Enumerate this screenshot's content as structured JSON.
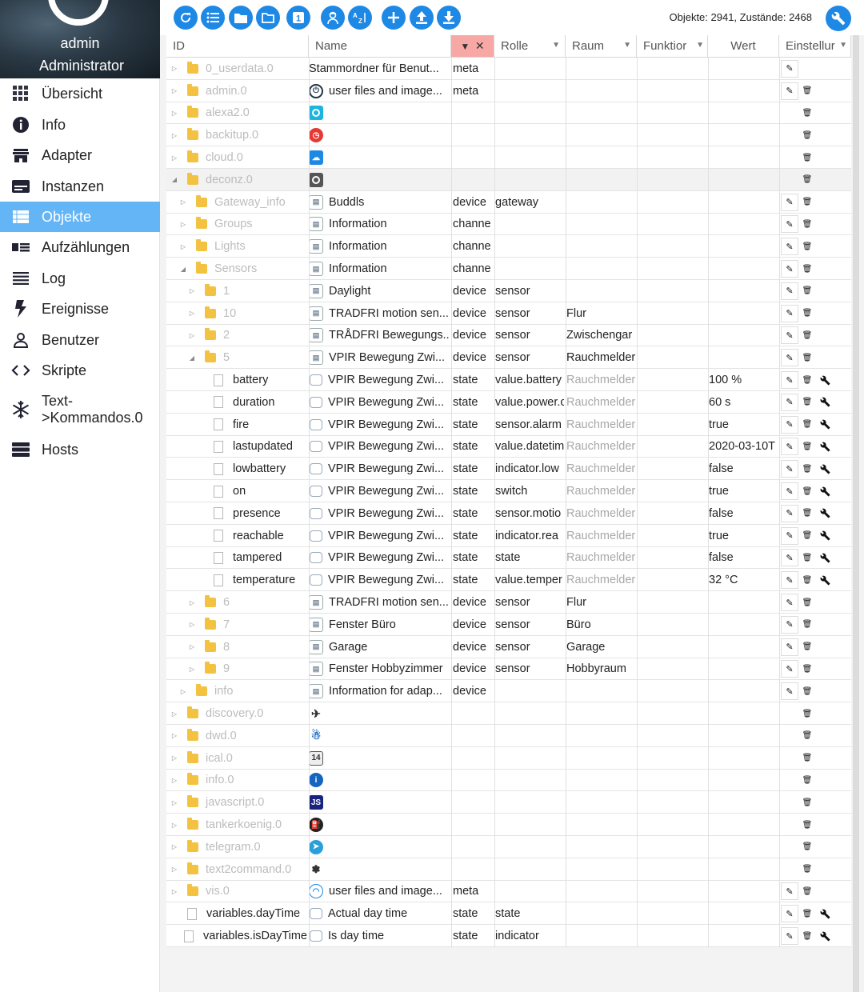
{
  "user": {
    "name": "admin",
    "role": "Administrator"
  },
  "nav": [
    {
      "label": "Übersicht",
      "icon": "grid-icon"
    },
    {
      "label": "Info",
      "icon": "info-icon"
    },
    {
      "label": "Adapter",
      "icon": "store-icon"
    },
    {
      "label": "Instanzen",
      "icon": "instances-icon"
    },
    {
      "label": "Objekte",
      "icon": "list-icon",
      "active": true
    },
    {
      "label": "Aufzählungen",
      "icon": "enum-icon"
    },
    {
      "label": "Log",
      "icon": "log-icon"
    },
    {
      "label": "Ereignisse",
      "icon": "bolt-icon"
    },
    {
      "label": "Benutzer",
      "icon": "user-icon"
    },
    {
      "label": "Skripte",
      "icon": "code-icon"
    },
    {
      "label": "Text-\n>Kommandos.0",
      "icon": "snowflake-icon"
    },
    {
      "label": "Hosts",
      "icon": "hosts-icon"
    }
  ],
  "toolbar": {
    "buttons": [
      "refresh-icon",
      "list-view-icon",
      "folder-icon",
      "folder-open-icon",
      "one-icon",
      "expert-icon",
      "sort-az-icon",
      "add-icon",
      "upload-icon",
      "download-icon"
    ],
    "stats": "Objekte: 2941, Zustände: 2468"
  },
  "columns": {
    "id": "ID",
    "name": "Name",
    "role": "Rolle",
    "room": "Raum",
    "func": "Funktior",
    "val": "Wert",
    "settings": "Einstellur"
  },
  "rows": [
    {
      "d": 0,
      "t": "c",
      "k": "f",
      "id": "0_userdata.0",
      "m": true,
      "icon": "",
      "name": "Stammordner für Benut...",
      "type": "meta",
      "role": "",
      "room": "",
      "val": "",
      "a": "e"
    },
    {
      "d": 0,
      "t": "c",
      "k": "f",
      "id": "admin.0",
      "m": true,
      "icon": "admin",
      "name": "user files and image...",
      "type": "meta",
      "role": "",
      "room": "",
      "val": "",
      "a": "ed"
    },
    {
      "d": 0,
      "t": "c",
      "k": "f",
      "id": "alexa2.0",
      "m": true,
      "icon": "alexa",
      "name": "",
      "type": "",
      "role": "",
      "room": "",
      "val": "",
      "a": "d"
    },
    {
      "d": 0,
      "t": "c",
      "k": "f",
      "id": "backitup.0",
      "m": true,
      "icon": "backitup",
      "name": "",
      "type": "",
      "role": "",
      "room": "",
      "val": "",
      "a": "d"
    },
    {
      "d": 0,
      "t": "c",
      "k": "f",
      "id": "cloud.0",
      "m": true,
      "icon": "cloud",
      "name": "",
      "type": "",
      "role": "",
      "room": "",
      "val": "",
      "a": "d"
    },
    {
      "d": 0,
      "t": "o",
      "k": "f",
      "id": "deconz.0",
      "m": true,
      "icon": "deconz",
      "name": "",
      "type": "",
      "role": "",
      "room": "",
      "val": "",
      "a": "d",
      "sel": true
    },
    {
      "d": 1,
      "t": "c",
      "k": "f",
      "id": "Gateway_info",
      "m": true,
      "icon": "doc",
      "name": "Buddls",
      "type": "device",
      "role": "gateway",
      "room": "",
      "val": "",
      "a": "ed"
    },
    {
      "d": 1,
      "t": "c",
      "k": "f",
      "id": "Groups",
      "m": true,
      "icon": "doc",
      "name": "Information",
      "type": "channe",
      "role": "",
      "room": "",
      "val": "",
      "a": "ed"
    },
    {
      "d": 1,
      "t": "c",
      "k": "f",
      "id": "Lights",
      "m": true,
      "icon": "doc",
      "name": "Information",
      "type": "channe",
      "role": "",
      "room": "",
      "val": "",
      "a": "ed"
    },
    {
      "d": 1,
      "t": "o",
      "k": "f",
      "id": "Sensors",
      "m": true,
      "icon": "doc",
      "name": "Information",
      "type": "channe",
      "role": "",
      "room": "",
      "val": "",
      "a": "ed"
    },
    {
      "d": 2,
      "t": "c",
      "k": "f",
      "id": "1",
      "m": true,
      "icon": "doc",
      "name": "Daylight",
      "type": "device",
      "role": "sensor",
      "room": "",
      "val": "",
      "a": "ed"
    },
    {
      "d": 2,
      "t": "c",
      "k": "f",
      "id": "10",
      "m": true,
      "icon": "doc",
      "name": "TRADFRI motion sen...",
      "type": "device",
      "role": "sensor",
      "room": "Flur",
      "val": "",
      "a": "ed"
    },
    {
      "d": 2,
      "t": "c",
      "k": "f",
      "id": "2",
      "m": true,
      "icon": "doc",
      "name": "TRÅDFRI Bewegungs...",
      "type": "device",
      "role": "sensor",
      "room": "Zwischengar",
      "val": "",
      "a": "ed"
    },
    {
      "d": 2,
      "t": "o",
      "k": "f",
      "id": "5",
      "m": true,
      "icon": "doc",
      "name": "VPIR Bewegung Zwi...",
      "type": "device",
      "role": "sensor",
      "room": "Rauchmelder",
      "val": "",
      "a": "ed"
    },
    {
      "d": 3,
      "t": "n",
      "k": "s",
      "id": "battery",
      "m": false,
      "icon": "st",
      "name": "VPIR Bewegung Zwi...",
      "type": "state",
      "role": "value.battery",
      "room": "Rauchmelder",
      "rm": true,
      "val": "100 %",
      "a": "edw"
    },
    {
      "d": 3,
      "t": "n",
      "k": "s",
      "id": "duration",
      "m": false,
      "icon": "st",
      "name": "VPIR Bewegung Zwi...",
      "type": "state",
      "role": "value.power.c",
      "room": "Rauchmelder",
      "rm": true,
      "val": "60 s",
      "a": "edw"
    },
    {
      "d": 3,
      "t": "n",
      "k": "s",
      "id": "fire",
      "m": false,
      "icon": "st",
      "name": "VPIR Bewegung Zwi...",
      "type": "state",
      "role": "sensor.alarm",
      "room": "Rauchmelder",
      "rm": true,
      "val": "true",
      "a": "edw"
    },
    {
      "d": 3,
      "t": "n",
      "k": "s",
      "id": "lastupdated",
      "m": false,
      "icon": "st",
      "name": "VPIR Bewegung Zwi...",
      "type": "state",
      "role": "value.datetim",
      "room": "Rauchmelder",
      "rm": true,
      "val": "2020-03-10T",
      "a": "edw"
    },
    {
      "d": 3,
      "t": "n",
      "k": "s",
      "id": "lowbattery",
      "m": false,
      "icon": "st",
      "name": "VPIR Bewegung Zwi...",
      "type": "state",
      "role": "indicator.low",
      "room": "Rauchmelder",
      "rm": true,
      "val": "false",
      "a": "edw"
    },
    {
      "d": 3,
      "t": "n",
      "k": "s",
      "id": "on",
      "m": false,
      "icon": "st",
      "name": "VPIR Bewegung Zwi...",
      "type": "state",
      "role": "switch",
      "room": "Rauchmelder",
      "rm": true,
      "val": "true",
      "a": "edw"
    },
    {
      "d": 3,
      "t": "n",
      "k": "s",
      "id": "presence",
      "m": false,
      "icon": "st",
      "name": "VPIR Bewegung Zwi...",
      "type": "state",
      "role": "sensor.motio",
      "room": "Rauchmelder",
      "rm": true,
      "val": "false",
      "a": "edw"
    },
    {
      "d": 3,
      "t": "n",
      "k": "s",
      "id": "reachable",
      "m": false,
      "icon": "st",
      "name": "VPIR Bewegung Zwi...",
      "type": "state",
      "role": "indicator.rea",
      "room": "Rauchmelder",
      "rm": true,
      "val": "true",
      "a": "edw"
    },
    {
      "d": 3,
      "t": "n",
      "k": "s",
      "id": "tampered",
      "m": false,
      "icon": "st",
      "name": "VPIR Bewegung Zwi...",
      "type": "state",
      "role": "state",
      "room": "Rauchmelder",
      "rm": true,
      "val": "false",
      "a": "edw"
    },
    {
      "d": 3,
      "t": "n",
      "k": "s",
      "id": "temperature",
      "m": false,
      "icon": "st",
      "name": "VPIR Bewegung Zwi...",
      "type": "state",
      "role": "value.temper",
      "room": "Rauchmelder",
      "rm": true,
      "val": "32 °C",
      "a": "edw"
    },
    {
      "d": 2,
      "t": "c",
      "k": "f",
      "id": "6",
      "m": true,
      "icon": "doc",
      "name": "TRADFRI motion sen...",
      "type": "device",
      "role": "sensor",
      "room": "Flur",
      "val": "",
      "a": "ed"
    },
    {
      "d": 2,
      "t": "c",
      "k": "f",
      "id": "7",
      "m": true,
      "icon": "doc",
      "name": "Fenster Büro",
      "type": "device",
      "role": "sensor",
      "room": "Büro",
      "val": "",
      "a": "ed"
    },
    {
      "d": 2,
      "t": "c",
      "k": "f",
      "id": "8",
      "m": true,
      "icon": "doc",
      "name": "Garage",
      "type": "device",
      "role": "sensor",
      "room": "Garage",
      "val": "",
      "a": "ed"
    },
    {
      "d": 2,
      "t": "c",
      "k": "f",
      "id": "9",
      "m": true,
      "icon": "doc",
      "name": "Fenster Hobbyzimmer",
      "type": "device",
      "role": "sensor",
      "room": "Hobbyraum",
      "val": "",
      "a": "ed"
    },
    {
      "d": 1,
      "t": "c",
      "k": "f",
      "id": "info",
      "m": true,
      "icon": "doc",
      "name": "Information for adap...",
      "type": "device",
      "role": "",
      "room": "",
      "val": "",
      "a": "ed"
    },
    {
      "d": 0,
      "t": "c",
      "k": "f",
      "id": "discovery.0",
      "m": true,
      "icon": "discovery",
      "name": "",
      "type": "",
      "role": "",
      "room": "",
      "val": "",
      "a": "d"
    },
    {
      "d": 0,
      "t": "c",
      "k": "f",
      "id": "dwd.0",
      "m": true,
      "icon": "dwd",
      "name": "",
      "type": "",
      "role": "",
      "room": "",
      "val": "",
      "a": "d"
    },
    {
      "d": 0,
      "t": "c",
      "k": "f",
      "id": "ical.0",
      "m": true,
      "icon": "ical",
      "name": "",
      "type": "",
      "role": "",
      "room": "",
      "val": "",
      "a": "d"
    },
    {
      "d": 0,
      "t": "c",
      "k": "f",
      "id": "info.0",
      "m": true,
      "icon": "info",
      "name": "",
      "type": "",
      "role": "",
      "room": "",
      "val": "",
      "a": "d"
    },
    {
      "d": 0,
      "t": "c",
      "k": "f",
      "id": "javascript.0",
      "m": true,
      "icon": "js",
      "name": "",
      "type": "",
      "role": "",
      "room": "",
      "val": "",
      "a": "d"
    },
    {
      "d": 0,
      "t": "c",
      "k": "f",
      "id": "tankerkoenig.0",
      "m": true,
      "icon": "tank",
      "name": "",
      "type": "",
      "role": "",
      "room": "",
      "val": "",
      "a": "d"
    },
    {
      "d": 0,
      "t": "c",
      "k": "f",
      "id": "telegram.0",
      "m": true,
      "icon": "telegram",
      "name": "",
      "type": "",
      "role": "",
      "room": "",
      "val": "",
      "a": "d"
    },
    {
      "d": 0,
      "t": "c",
      "k": "f",
      "id": "text2command.0",
      "m": true,
      "icon": "brain",
      "name": "",
      "type": "",
      "role": "",
      "room": "",
      "val": "",
      "a": "d"
    },
    {
      "d": 0,
      "t": "c",
      "k": "f",
      "id": "vis.0",
      "m": true,
      "icon": "vis",
      "name": "user files and image...",
      "type": "meta",
      "role": "",
      "room": "",
      "val": "",
      "a": "ed"
    },
    {
      "d": 0,
      "t": "n",
      "k": "s",
      "id": "variables.dayTime",
      "m": false,
      "icon": "st",
      "name": "Actual day time",
      "type": "state",
      "role": "state",
      "room": "",
      "val": "",
      "a": "edw"
    },
    {
      "d": 0,
      "t": "n",
      "k": "s",
      "id": "variables.isDayTime",
      "m": false,
      "icon": "st",
      "name": "Is day time",
      "type": "state",
      "role": "indicator",
      "room": "",
      "val": "",
      "a": "edw"
    }
  ]
}
